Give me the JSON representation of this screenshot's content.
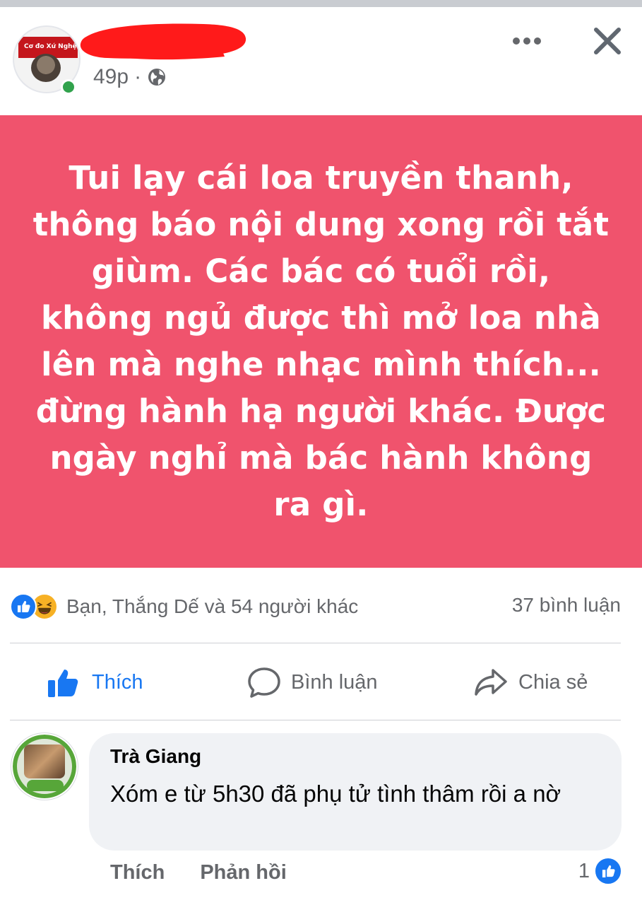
{
  "post": {
    "author": {
      "name_redacted": true,
      "avatar_caption": "Cơ đo Xứ Nghệ",
      "online": true
    },
    "time": "49p",
    "separator": "·",
    "privacy_icon": "globe-icon",
    "more_icon": "ellipsis-icon",
    "close_icon": "close-icon",
    "background_color": "#f0536d",
    "text": "Tui lạy cái loa truyền thanh, thông báo nội dung xong rồi tắt giùm. Các bác có tuổi rồi, không ngủ được thì mở loa nhà lên mà nghe nhạc mình thích... đừng hành hạ người khác. Được ngày nghỉ mà bác hành không ra gì."
  },
  "reactions": {
    "icons": [
      "like-reaction-icon",
      "haha-reaction-icon"
    ],
    "summary": "Bạn, Thắng Dế và 54 người khác",
    "comment_count": "37 bình luận"
  },
  "actions": {
    "like": "Thích",
    "comment": "Bình luận",
    "share": "Chia sẻ"
  },
  "comment": {
    "author": "Trà Giang",
    "text": "Xóm e từ 5h30 đã phụ tử tình thâm rồi a nờ",
    "like_label": "Thích",
    "reply_label": "Phản hồi",
    "reaction_count": "1"
  },
  "colors": {
    "brand_blue": "#1877f2",
    "secondary_text": "#65676b",
    "online_green": "#31a24c",
    "bubble_bg": "#f0f2f5",
    "redaction": "#ff1a1a"
  }
}
